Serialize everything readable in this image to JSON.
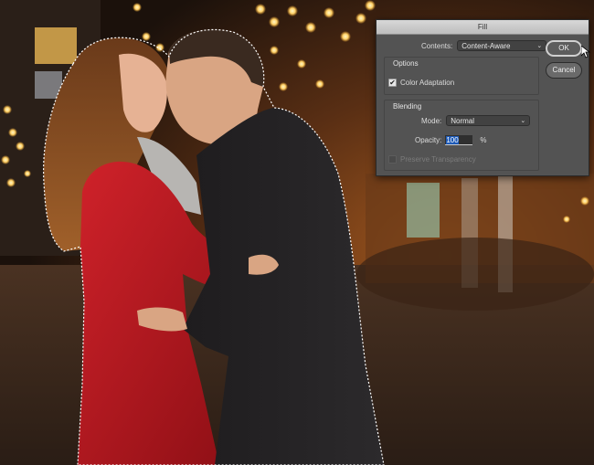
{
  "dialog": {
    "title": "Fill",
    "contents_label": "Contents:",
    "contents_value": "Content-Aware",
    "ok_label": "OK",
    "cancel_label": "Cancel",
    "options_title": "Options",
    "color_adaptation_label": "Color Adaptation",
    "color_adaptation_checked": true,
    "blending_title": "Blending",
    "mode_label": "Mode:",
    "mode_value": "Normal",
    "opacity_label": "Opacity:",
    "opacity_value": "100",
    "opacity_unit": "%",
    "preserve_label": "Preserve Transparency",
    "preserve_checked": false
  },
  "icons": {
    "checkmark": "check-icon",
    "dropdown": "chevron-down-icon",
    "cursor": "arrow-cursor-icon"
  },
  "colors": {
    "dialog_bg": "#535353",
    "highlight": "#1e5bb8",
    "coat_red": "#b5141c"
  }
}
